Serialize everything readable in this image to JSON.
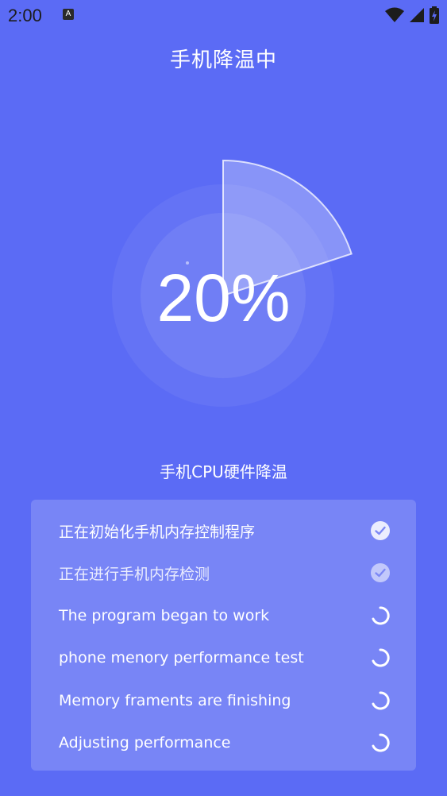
{
  "status_bar": {
    "time": "2:00",
    "notification_glyph": "A",
    "icons": [
      "wifi-icon",
      "signal-icon",
      "battery-charging-icon"
    ]
  },
  "header": {
    "title": "手机降温中"
  },
  "gauge": {
    "percent_label": "20%",
    "progress": 0.2
  },
  "subtitle": "手机CPU硬件降温",
  "tasks": [
    {
      "label": "正在初始化手机内存控制程序",
      "status": "done",
      "icon": "check-circle-icon"
    },
    {
      "label": "正在进行手机内存检测",
      "status": "done-dim",
      "icon": "check-circle-icon"
    },
    {
      "label": "The program began to work",
      "status": "loading",
      "icon": "spinner-icon"
    },
    {
      "label": "phone menory performance test",
      "status": "loading",
      "icon": "spinner-icon"
    },
    {
      "label": "Memory framents are finishing",
      "status": "loading",
      "icon": "spinner-icon"
    },
    {
      "label": "Adjusting performance",
      "status": "loading",
      "icon": "spinner-icon"
    }
  ],
  "colors": {
    "background": "#5B6BF5",
    "card": "rgba(255,255,255,0.18)",
    "text": "#FFFFFF"
  }
}
